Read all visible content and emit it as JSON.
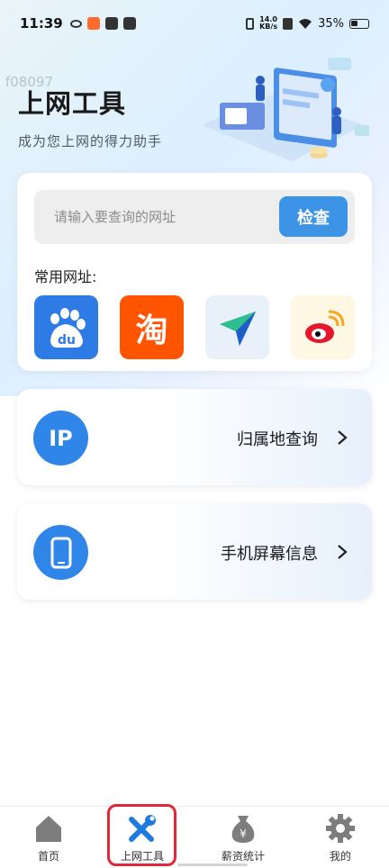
{
  "status_bar": {
    "time": "11:39",
    "net_speed_value": "14.0",
    "net_speed_unit": "KB/s",
    "battery": "35%"
  },
  "watermark": "f08097",
  "hero": {
    "title": "上网工具",
    "subtitle": "成为您上网的得力助手"
  },
  "search": {
    "placeholder": "请输入要查询的网址",
    "value": "",
    "button_label": "检查"
  },
  "common_sites": {
    "label": "常用网址:",
    "items": [
      {
        "name": "baidu",
        "icon": "baidu-icon",
        "color": "#2e7be6",
        "glyph_text": "du"
      },
      {
        "name": "taobao",
        "icon": "taobao-icon",
        "color": "#ff5500",
        "glyph_text": "淘"
      },
      {
        "name": "send",
        "icon": "paper-plane-icon",
        "color": "#e8f0fa"
      },
      {
        "name": "weibo",
        "icon": "weibo-icon",
        "color": "#fdf7e4"
      }
    ]
  },
  "tools": [
    {
      "label": "归属地查询",
      "icon": "ip-icon",
      "icon_text": "IP"
    },
    {
      "label": "手机屏幕信息",
      "icon": "phone-icon"
    }
  ],
  "tabbar": {
    "items": [
      {
        "label": "首页",
        "icon": "home-icon"
      },
      {
        "label": "上网工具",
        "icon": "tools-icon",
        "active": true
      },
      {
        "label": "薪资统计",
        "icon": "money-bag-icon"
      },
      {
        "label": "我的",
        "icon": "gear-icon"
      }
    ]
  },
  "colors": {
    "accent": "#3d93e6",
    "tool_icon_bg": "#2f86e8",
    "highlight": "#e0283a"
  }
}
